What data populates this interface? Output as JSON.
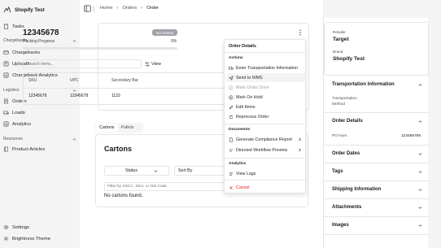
{
  "app": {
    "name": "Shopify Test"
  },
  "sidebar": {
    "top_items": [
      {
        "label": "Tasks",
        "icon": "clipboard-icon"
      }
    ],
    "groups": [
      {
        "label": "Chargebacks",
        "items": [
          {
            "label": "Chargebacks",
            "icon": "chargeback-icon"
          },
          {
            "label": "Uploads",
            "icon": "upload-icon"
          },
          {
            "label": "Chargeback Analytics",
            "icon": "chart-icon"
          }
        ]
      },
      {
        "label": "Logistics",
        "items": [
          {
            "label": "Orders",
            "icon": "orders-icon"
          },
          {
            "label": "Loads",
            "icon": "truck-icon"
          },
          {
            "label": "Analytics",
            "icon": "chart-icon"
          }
        ]
      },
      {
        "label": "Resources",
        "items": [
          {
            "label": "Product Articles",
            "icon": "book-icon"
          }
        ]
      }
    ],
    "bottom_items": [
      {
        "label": "Settings",
        "icon": "gear-icon"
      },
      {
        "label": "Brightness Theme",
        "icon": "sun-icon"
      }
    ]
  },
  "breadcrumb": {
    "home": "Home",
    "orders": "Orders",
    "current": "Order",
    "separator": "›"
  },
  "order": {
    "id": "12345678",
    "status_badge": "Not started",
    "progress_label": "Packing Progress",
    "progress_value": "0%",
    "progress_fraction": 0,
    "search_placeholder": "Search items...",
    "view_label": "View",
    "table": {
      "headers": [
        "SKU",
        "UPC",
        "Secondary Bar"
      ],
      "rows": [
        [
          "12345678",
          "12345678",
          "1123"
        ]
      ]
    }
  },
  "tabs": {
    "cartons": "Cartons",
    "pallets": "Pallets"
  },
  "cartons": {
    "title": "Cartons",
    "status_filter": "Status",
    "sort_filter": "Sort By",
    "filter_placeholder": "Filter by SSCC, SKU, or GM Code",
    "empty_text": "No cartons found."
  },
  "menu": {
    "title": "Order Details",
    "actions_label": "Actions",
    "actions": [
      {
        "label": "Enter Transportation Information",
        "icon": "truck-icon"
      },
      {
        "label": "Send to WMS",
        "icon": "send-icon"
      },
      {
        "label": "Mark Order Done",
        "icon": "check-icon"
      },
      {
        "label": "Mark On Hold",
        "icon": "pause-icon"
      },
      {
        "label": "Edit Items",
        "icon": "edit-icon"
      },
      {
        "label": "Reprocess Order",
        "icon": "refresh-icon"
      }
    ],
    "documents_label": "Documents",
    "documents": [
      {
        "label": "Generate Compliance Report",
        "icon": "file-icon"
      },
      {
        "label": "Directed Workflow Preview",
        "icon": "workflow-icon"
      }
    ],
    "analytics_label": "Analytics",
    "analytics": [
      {
        "label": "View Logs",
        "icon": "logs-icon"
      }
    ],
    "cancel": "Cancel",
    "colors": {
      "danger": "#dc2626",
      "disabled": "#a1a1aa"
    }
  },
  "right_panel": {
    "retailer_label": "Retailer",
    "retailer": "Target",
    "brand_label": "Brand",
    "brand": "Shopify Test",
    "sections": {
      "transportation": {
        "title": "Transportation Information",
        "sub_label_1": "Transportation",
        "sub_label_2": "Method"
      },
      "order_details": {
        "title": "Order Details",
        "po_label": "PO Num.",
        "po_value": "123456789"
      },
      "order_dates": {
        "title": "Order Dates"
      },
      "tags": {
        "title": "Tags"
      },
      "shipping": {
        "title": "Shipping Information"
      },
      "attachments": {
        "title": "Attachments"
      },
      "images": {
        "title": "Images"
      }
    }
  }
}
